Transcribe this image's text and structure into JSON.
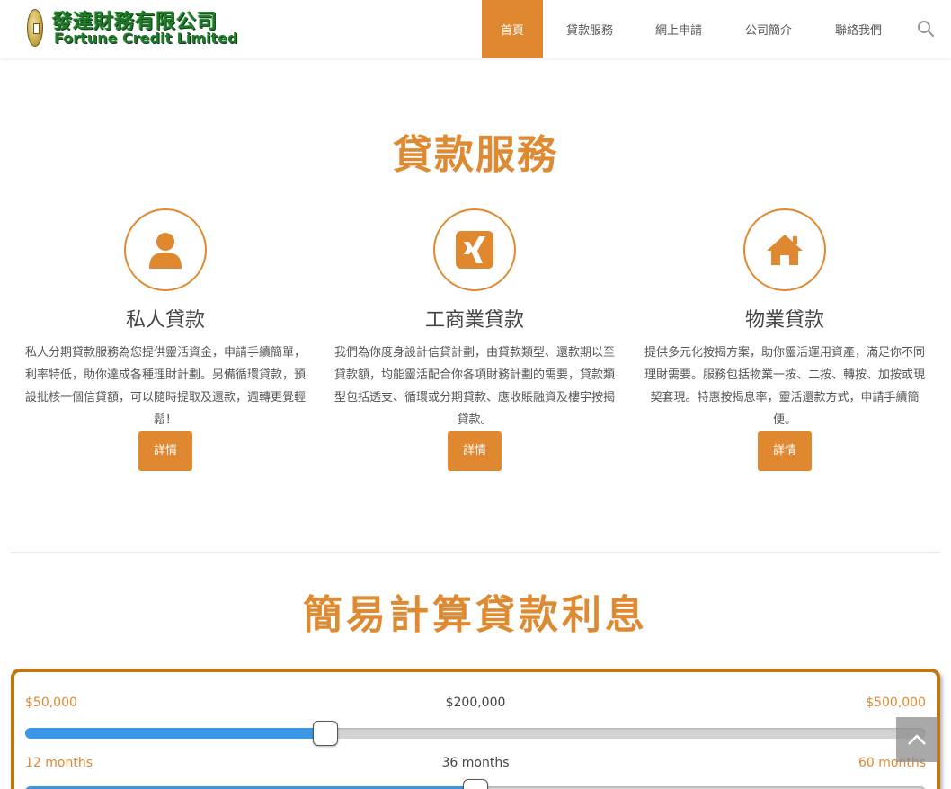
{
  "header": {
    "logo_cn": "發達財務有限公司",
    "logo_en": "Fortune Credit Limited",
    "nav": [
      {
        "label": "首頁",
        "active": true
      },
      {
        "label": "貸款服務",
        "active": false
      },
      {
        "label": "網上申請",
        "active": false
      },
      {
        "label": "公司簡介",
        "active": false
      },
      {
        "label": "聯絡我們",
        "active": false
      }
    ],
    "search_icon": "search-icon"
  },
  "services": {
    "title": "貸款服務",
    "items": [
      {
        "icon": "user-icon",
        "name": "私人貸款",
        "desc": "私人分期貸款服務為您提供靈活資金，申請手續簡單，利率特低，助你達成各種理財計劃。另備循環貸款，預設批核一個信貸額，可以隨時提取及還款，週轉更覺輕鬆！",
        "button": "詳情"
      },
      {
        "icon": "xing-icon",
        "name": "工商業貸款",
        "desc": "我們為你度身設計信貸計劃，由貸款類型、還款期以至貸款額，均能靈活配合你各項財務計劃的需要，貸款類型包括透支、循環或分期貸款、應收賬融資及樓宇按揭貸款。",
        "button": "詳情"
      },
      {
        "icon": "home-icon",
        "name": "物業貸款",
        "desc": "提供多元化按揭方案，助你靈活運用資產，滿足你不同理財需要。服務包括物業一按、二按、轉按、加按或現契套現。特惠按揭息率，靈活還款方式，申請手續簡便。",
        "button": "詳情"
      }
    ]
  },
  "calculator": {
    "title": "簡易計算貸款利息",
    "amount": {
      "min_label": "$50,000",
      "value_label": "$200,000",
      "max_label": "$500,000",
      "min": 50000,
      "max": 500000,
      "value": 200000
    },
    "term": {
      "min_label": "12 months",
      "value_label": "36 months",
      "max_label": "60 months",
      "min": 12,
      "max": 60,
      "value": 36
    }
  },
  "colors": {
    "accent": "#e0882f",
    "border": "#c07712",
    "slider_fill": "#3b96e6"
  },
  "back_to_top_icon": "chevron-up-icon"
}
